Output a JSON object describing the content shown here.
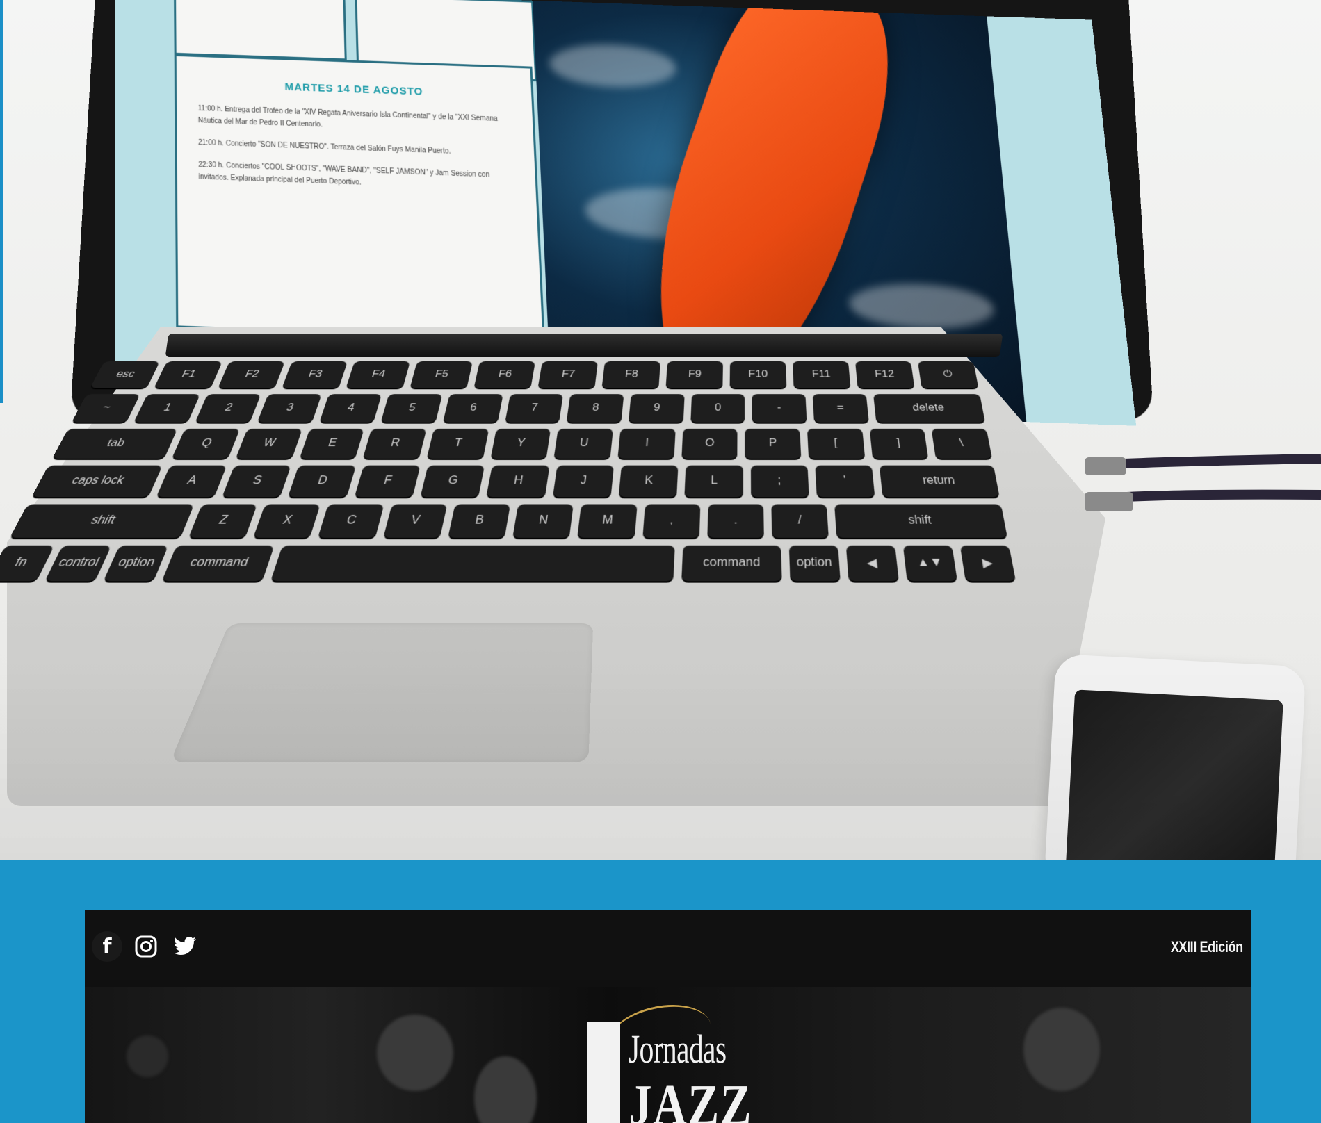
{
  "laptop_screen": {
    "heading": "MARTES 14 DE AGOSTO",
    "lines": [
      "11:00 h. Entrega del Trofeo de la \"XIV Regata Aniversario Isla Continental\" y de la \"XXI Semana Náutica del Mar de Pedro II Centenario.",
      "21:00 h. Concierto \"SON DE NUESTRO\". Terraza del Salón Fuys Manila Puerto.",
      "22:30 h. Conciertos \"COOL SHOOTS\", \"WAVE BAND\", \"SELF JAMSON\" y Jam Session con invitados. Explanada principal del Puerto Deportivo."
    ]
  },
  "keyboard": {
    "row1": [
      "esc",
      "F1",
      "F2",
      "F3",
      "F4",
      "F5",
      "F6",
      "F7",
      "F8",
      "F9",
      "F10",
      "F11",
      "F12",
      "⏻"
    ],
    "row2": [
      "~",
      "1",
      "2",
      "3",
      "4",
      "5",
      "6",
      "7",
      "8",
      "9",
      "0",
      "-",
      "=",
      "delete"
    ],
    "row3": [
      "tab",
      "Q",
      "W",
      "E",
      "R",
      "T",
      "Y",
      "U",
      "I",
      "O",
      "P",
      "[",
      "]",
      "\\"
    ],
    "row4": [
      "caps lock",
      "A",
      "S",
      "D",
      "F",
      "G",
      "H",
      "J",
      "K",
      "L",
      ";",
      "'",
      "return"
    ],
    "row5": [
      "shift",
      "Z",
      "X",
      "C",
      "V",
      "B",
      "N",
      "M",
      ",",
      ".",
      "/",
      "shift"
    ],
    "row6": [
      "fn",
      "control",
      "option",
      "command",
      "",
      "command",
      "option",
      "◀",
      "▲▼",
      "▶"
    ]
  },
  "site": {
    "social": {
      "facebook": "f",
      "instagram_icon": "instagram-icon",
      "twitter_icon": "twitter-icon"
    },
    "edition": "XXIII Edición",
    "logo": {
      "word": "Jornadas",
      "jazz": "JAZZ"
    }
  },
  "colors": {
    "band_blue": "#1b95c9",
    "site_bg": "#101010",
    "hull_orange": "#e94a12",
    "screen_teal": "#b9e0e6",
    "heading_teal": "#1c9ba8",
    "logo_gold": "#c9a24a"
  }
}
